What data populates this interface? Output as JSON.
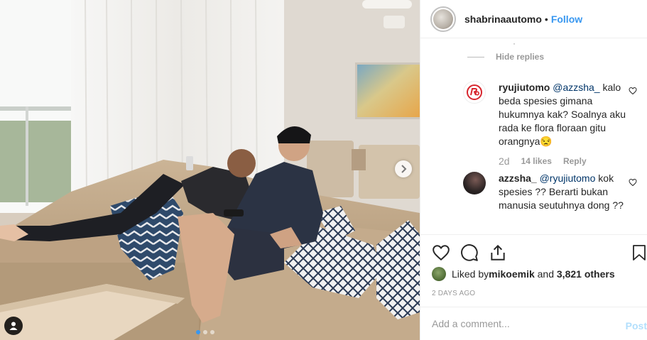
{
  "post": {
    "username": "shabrinaautomo",
    "separator": "•",
    "follow_label": "Follow",
    "carousel_dots": 3,
    "active_dot": 0
  },
  "comments": {
    "cut_text": "·",
    "hide_replies_label": "Hide replies",
    "items": [
      {
        "username": "ryujiutomo",
        "mention": "@azzsha_",
        "text": " kalo beda spesies gimana hukumnya kak? Soalnya aku rada ke flora floraan gitu orangnya😒",
        "age": "2d",
        "likes": "14 likes",
        "reply_label": "Reply"
      },
      {
        "username": "azzsha_",
        "mention": "@ryujiutomo",
        "text": " kok spesies ?? Berarti bukan manusia seutuhnya dong ??"
      }
    ]
  },
  "actions": {
    "icons": [
      "heart-icon",
      "comment-icon",
      "share-icon",
      "bookmark-icon"
    ]
  },
  "likes": {
    "prefix": "Liked by ",
    "liker": "mikoemik",
    "middle": " and ",
    "others": "3,821 others"
  },
  "timestamp": "2 days ago",
  "add_comment": {
    "placeholder": "Add a comment...",
    "post_label": "Post"
  },
  "colors": {
    "accent": "#3897f0",
    "mention": "#003569",
    "muted": "#999999",
    "post_disabled": "#b2dffc"
  }
}
